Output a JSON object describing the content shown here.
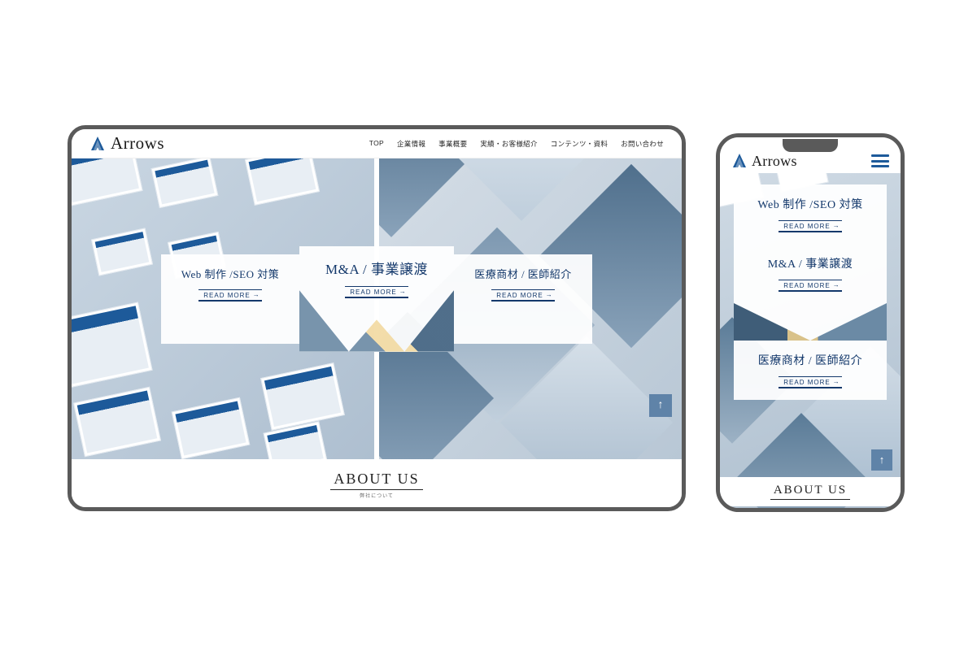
{
  "brand": {
    "name": "Arrows"
  },
  "nav": {
    "items": [
      {
        "label": "TOP"
      },
      {
        "label": "企業情報"
      },
      {
        "label": "事業概要"
      },
      {
        "label": "実績・お客様紹介"
      },
      {
        "label": "コンテンツ・資料"
      },
      {
        "label": "お問い合わせ"
      }
    ]
  },
  "services": {
    "left": {
      "title": "Web 制作 /SEO 対策",
      "cta": "READ MORE"
    },
    "center": {
      "title": "M&A / 事業譲渡",
      "cta": "READ MORE"
    },
    "right": {
      "title": "医療商材 / 医師紹介",
      "cta": "READ MORE"
    }
  },
  "about": {
    "heading": "ABOUT US",
    "sub": "弊社について"
  },
  "ui": {
    "scroll_top_glyph": "↑"
  },
  "colors": {
    "accent": "#13386b",
    "scroll_btn": "#5f83a8"
  }
}
